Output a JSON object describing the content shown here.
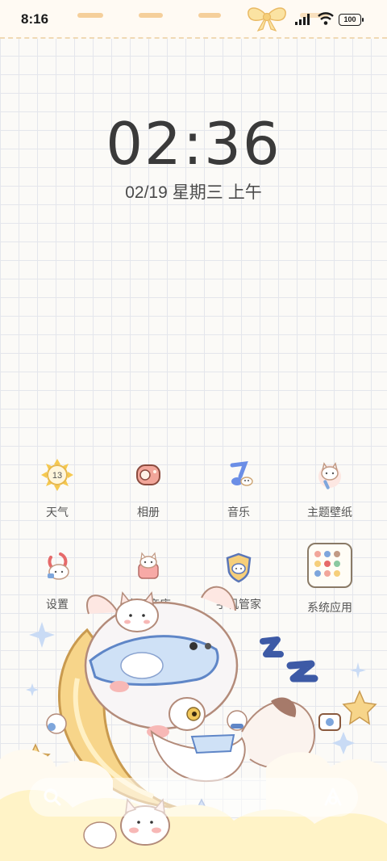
{
  "status_bar": {
    "time": "8:16",
    "battery": "100"
  },
  "lockscreen": {
    "clock": "02:36",
    "date": "02/19",
    "weekday": "星期三",
    "ampm": "上午"
  },
  "apps": [
    {
      "label": "天气",
      "icon": "sun-badge-icon",
      "badge": "13"
    },
    {
      "label": "相册",
      "icon": "photo-album-icon"
    },
    {
      "label": "音乐",
      "icon": "music-note-icon"
    },
    {
      "label": "主题壁纸",
      "icon": "cat-brush-icon"
    },
    {
      "label": "设置",
      "icon": "cat-gear-icon"
    },
    {
      "label": "应用商店",
      "icon": "cat-bag-icon"
    },
    {
      "label": "手机管家",
      "icon": "cat-shield-icon"
    },
    {
      "label": "系统应用",
      "icon": "folder-icon"
    }
  ],
  "colors": {
    "accent_yellow": "#f7d58a",
    "lace_trim": "#f5cf9b",
    "grid_line": "#e4e6ec",
    "mask_blue": "#7ea6dc"
  }
}
